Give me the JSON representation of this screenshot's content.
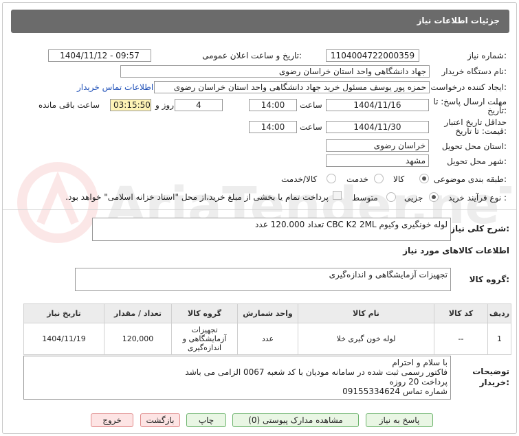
{
  "header": {
    "title": "جزئیات اطلاعات نیاز"
  },
  "form": {
    "need_number_label": "شماره نیاز:",
    "need_number": "1104004722000359",
    "announce_label": "تاریخ و ساعت اعلان عمومی:",
    "announce_value": "1404/11/12 - 09:57",
    "buyer_label": "نام دستگاه خریدار:",
    "buyer_value": "جهاد دانشگاهی واحد استان خراسان رضوی",
    "creator_label": "ایجاد کننده درخواست:",
    "creator_value": "حمزه  پور یوسف مسئول خرید جهاد دانشگاهی واحد استان خراسان رضوی",
    "contact_link": "اطلاعات تماس خریدار",
    "deadline_label_1": "مهلت ارسال پاسخ: تا",
    "deadline_label_2": "تاریخ:",
    "deadline_date": "1404/11/16",
    "time_label": "ساعت",
    "deadline_time": "14:00",
    "days_value": "4",
    "days_label": "روز و",
    "remaining_value": "03:15:50",
    "remaining_label": "ساعت باقی مانده",
    "validity_label_1": "حداقل تاریخ اعتبار",
    "validity_label_2": "قیمت: تا تاریخ:",
    "validity_date": "1404/11/30",
    "validity_time": "14:00",
    "province_label": "استان محل تحویل:",
    "province_value": "خراسان رضوی",
    "city_label": "شهر محل تحویل:",
    "city_value": "مشهد",
    "category_label": "طبقه بندی موضوعی:",
    "category_options": [
      "کالا",
      "خدمت",
      "کالا/خدمت"
    ],
    "process_label": "نوع فرآیند خرید :",
    "process_options": [
      "جزیی",
      "متوسط"
    ],
    "payment_note": "پرداخت تمام یا بخشی از مبلغ خرید،از محل \"اسناد خزانه اسلامی\" خواهد بود."
  },
  "summary": {
    "label": "شرح کلی نیاز:",
    "value": "لوله خونگیری وکیوم CBC K2 2ML تعداد 120.000 عدد"
  },
  "goods_info_title": "اطلاعات کالاهای مورد نیاز",
  "goods_group": {
    "label": "گروه کالا:",
    "value": "تجهیزات آزمایشگاهی و اندازه‌گیری"
  },
  "goods_table": {
    "headers": [
      "ردیف",
      "کد کالا",
      "نام کالا",
      "واحد شمارش",
      "گروه کالا",
      "تعداد / مقدار",
      "تاریخ نیاز"
    ],
    "rows": [
      [
        "1",
        "--",
        "لوله خون گیری خلا",
        "عدد",
        "تجهیزات آزمایشگاهی و اندازه‌گیری",
        "120,000",
        "1404/11/19"
      ]
    ]
  },
  "buyer_notes": {
    "label_1": "توضیحات",
    "label_2": "خریدار:",
    "lines": [
      "با سلام و احترام",
      "فاکتور رسمی ثبت شده در سامانه مودیان با کد شعبه 0067 الزامی می باشد",
      "پرداخت 20 روزه",
      "شماره تماس 09155334624"
    ]
  },
  "buttons": {
    "reply": "پاسخ به نیاز",
    "attachments": "مشاهده مدارک پیوستی (0)",
    "print": "چاپ",
    "back": "بازگشت",
    "exit": "خروج"
  },
  "watermark_text": "AriaTender.neT",
  "colors": {
    "title_bar": "#6b6b6b",
    "link": "#1e4fb7",
    "highlight": "#fef3b6",
    "button_green": "#e9f6e4",
    "button_red": "#fde4e4"
  }
}
